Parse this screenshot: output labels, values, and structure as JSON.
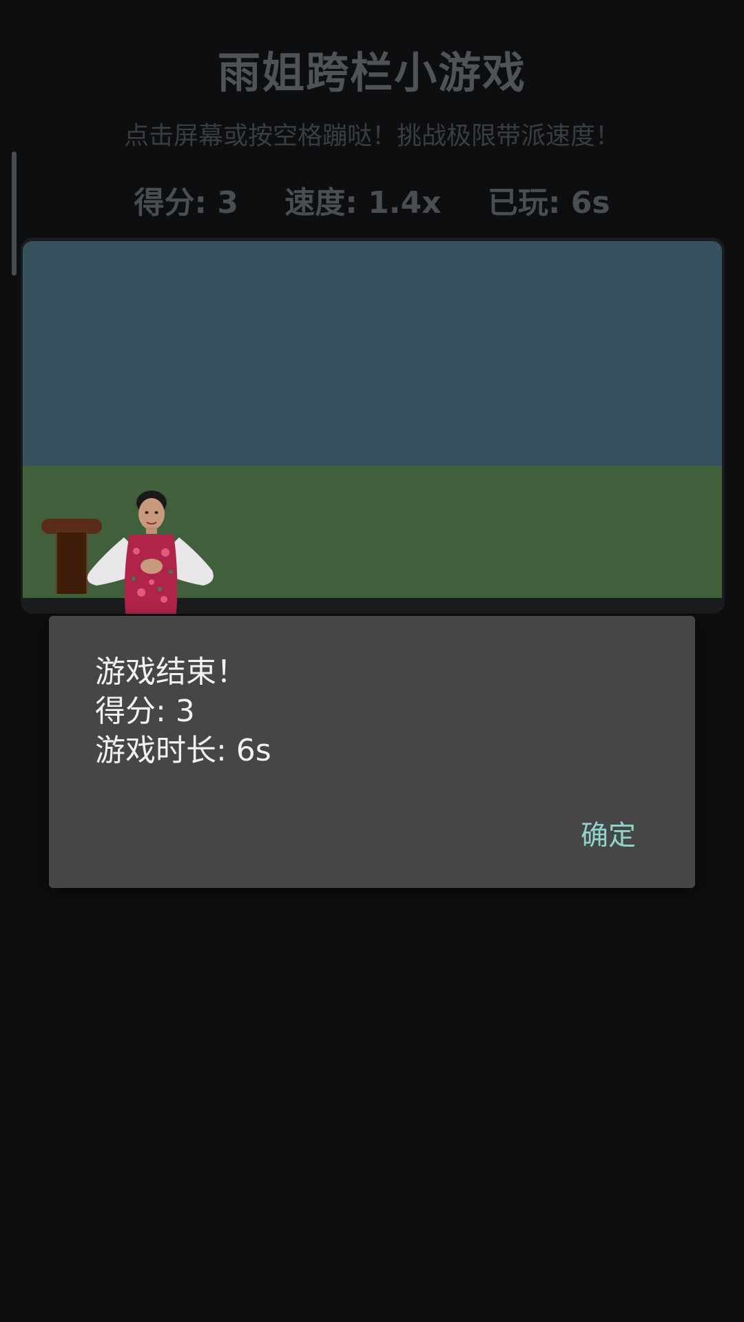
{
  "header": {
    "title": "雨姐跨栏小游戏",
    "subtitle": "点击屏幕或按空格蹦哒！挑战极限带派速度！"
  },
  "stats": {
    "score": "得分: 3",
    "speed": "速度: 1.4x",
    "played": "已玩: 6s"
  },
  "game": {
    "colors": {
      "sky": "#37525f",
      "ground": "#3f603b",
      "hurdle": "#5b2d18"
    },
    "objects": [
      "hurdle",
      "player-character"
    ]
  },
  "dialog": {
    "line1": "游戏结束！",
    "line2": "得分: 3",
    "line3": "游戏时长: 6s",
    "confirm_label": "确定",
    "accent": "#8fd3cc"
  }
}
